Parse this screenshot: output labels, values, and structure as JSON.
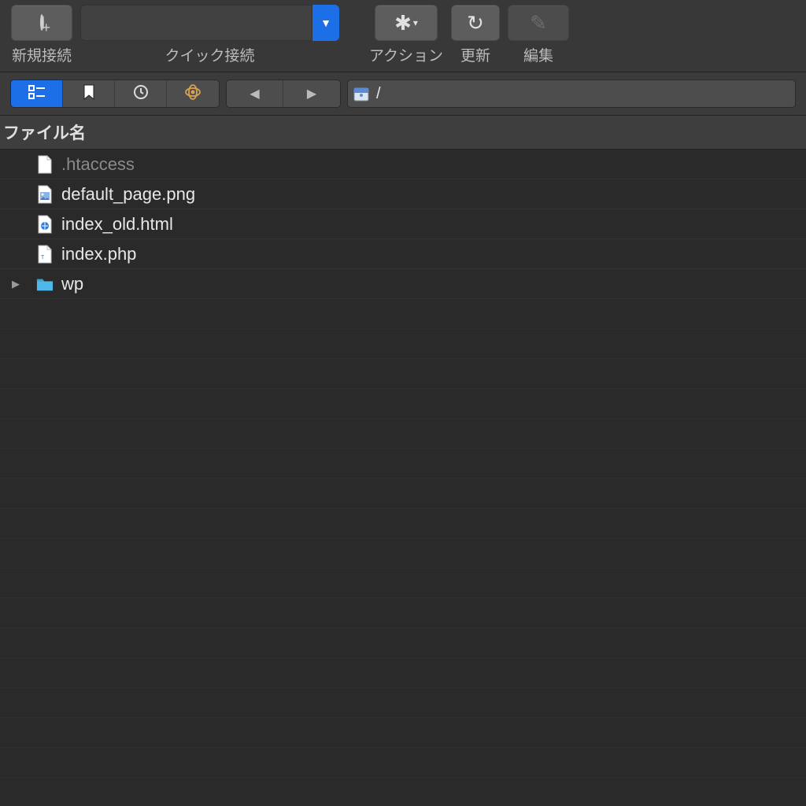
{
  "toolbar": {
    "new_connection_label": "新規接続",
    "quick_connect_label": "クイック接続",
    "action_label": "アクション",
    "refresh_label": "更新",
    "edit_label": "編集"
  },
  "path": {
    "current": "/"
  },
  "columns": {
    "filename": "ファイル名"
  },
  "files": [
    {
      "name": ".htaccess",
      "type": "file",
      "dim": true
    },
    {
      "name": "default_page.png",
      "type": "image",
      "dim": false
    },
    {
      "name": "index_old.html",
      "type": "html",
      "dim": false
    },
    {
      "name": "index.php",
      "type": "php",
      "dim": false
    },
    {
      "name": "wp",
      "type": "folder",
      "dim": false
    }
  ]
}
